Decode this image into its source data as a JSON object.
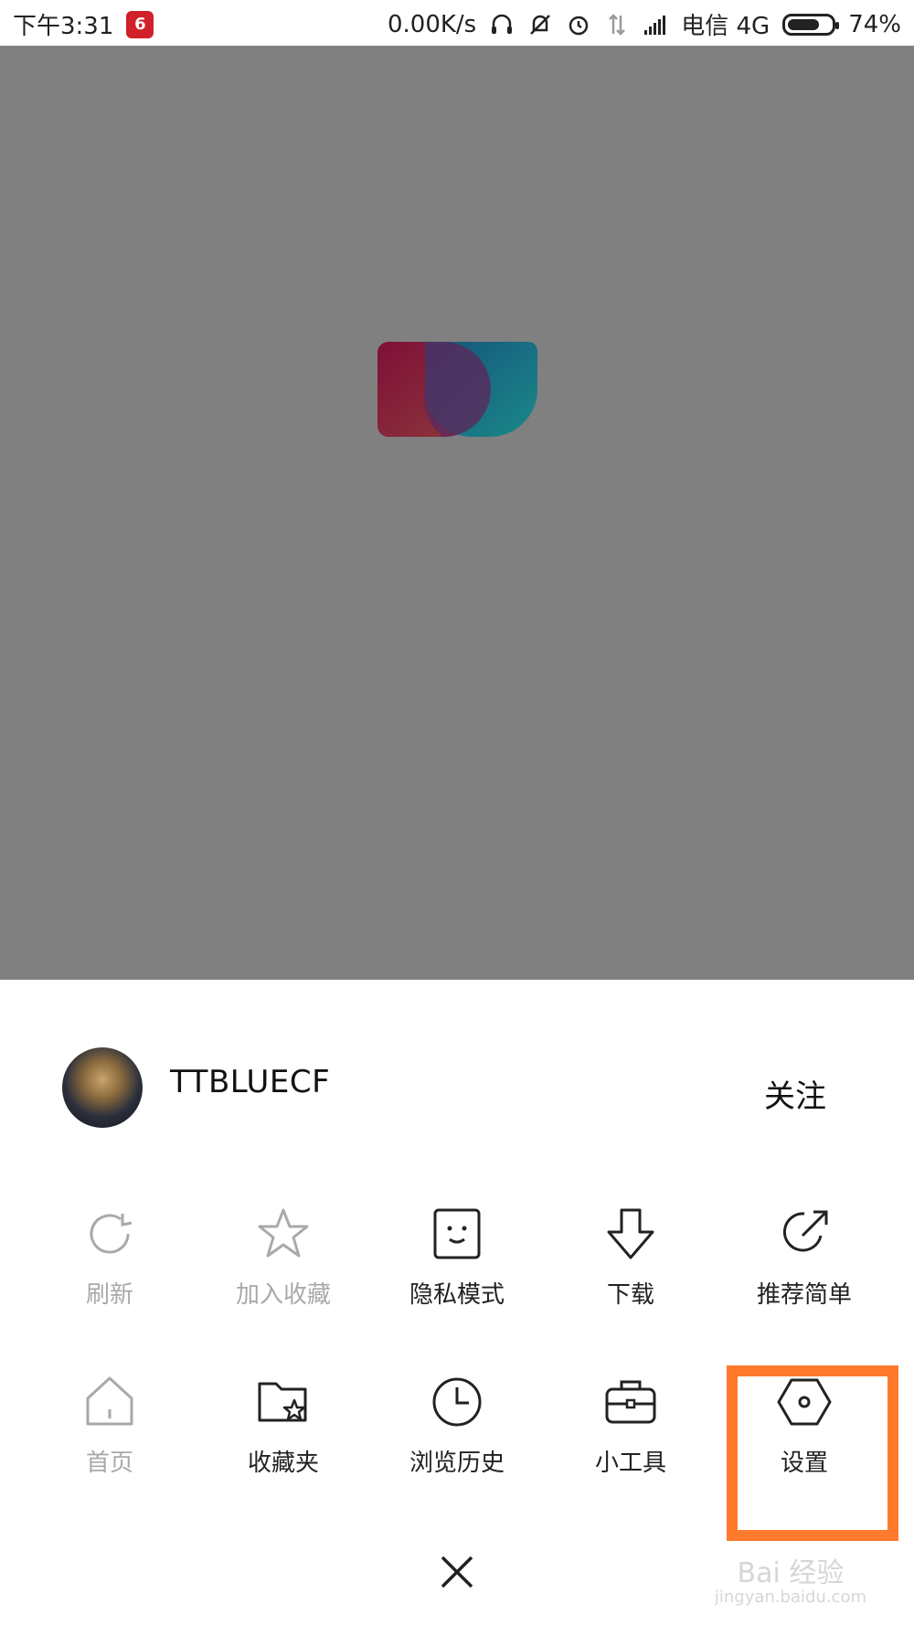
{
  "status_bar": {
    "time": "下午3:31",
    "app_badge": "6",
    "net_speed": "0.00K/s",
    "carrier": "电信 4G",
    "battery_percent": "74%",
    "battery_level": 0.74,
    "icons": [
      "headphone-icon",
      "mute-bell-icon",
      "alarm-icon",
      "data-arrows-icon",
      "signal-icon"
    ]
  },
  "profile": {
    "username": "TTBLUECF",
    "follow_label": "关注"
  },
  "menu": {
    "row1": [
      {
        "label": "刷新",
        "icon": "refresh-icon",
        "enabled": false
      },
      {
        "label": "加入收藏",
        "icon": "star-icon",
        "enabled": false
      },
      {
        "label": "隐私模式",
        "icon": "face-icon",
        "enabled": true
      },
      {
        "label": "下载",
        "icon": "download-icon",
        "enabled": true
      },
      {
        "label": "推荐简单",
        "icon": "share-icon",
        "enabled": true
      }
    ],
    "row2": [
      {
        "label": "首页",
        "icon": "home-icon",
        "enabled": false
      },
      {
        "label": "收藏夹",
        "icon": "folder-star-icon",
        "enabled": true
      },
      {
        "label": "浏览历史",
        "icon": "clock-icon",
        "enabled": true
      },
      {
        "label": "小工具",
        "icon": "toolbox-icon",
        "enabled": true
      },
      {
        "label": "设置",
        "icon": "settings-hexagon-icon",
        "enabled": true
      }
    ]
  },
  "highlight_color": "#ff7a2b",
  "overlay_color": "#808080",
  "watermark": {
    "main": "Bai 经验",
    "sub": "jingyan.baidu.com"
  }
}
